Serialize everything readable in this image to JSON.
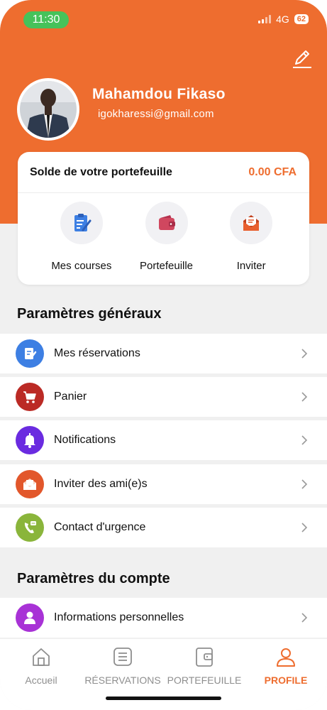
{
  "status_bar": {
    "time": "11:30",
    "network": "4G",
    "battery": "62"
  },
  "profile": {
    "name": "Mahamdou Fikaso",
    "email": "igokharessi@gmail.com"
  },
  "wallet": {
    "label": "Solde de votre portefeuille",
    "amount": "0.00 CFA"
  },
  "quick_actions": [
    {
      "label": "Mes courses",
      "icon": "clipboard-icon"
    },
    {
      "label": "Portefeuille",
      "icon": "wallet-icon"
    },
    {
      "label": "Inviter",
      "icon": "envelope-icon"
    }
  ],
  "general_settings": {
    "title": "Paramètres généraux",
    "items": [
      {
        "label": "Mes réservations",
        "icon": "reservation-icon",
        "color": "#3d7fe3"
      },
      {
        "label": "Panier",
        "icon": "cart-icon",
        "color": "#bb2a25"
      },
      {
        "label": "Notifications",
        "icon": "bell-icon",
        "color": "#6a2be0"
      },
      {
        "label": "Inviter des ami(e)s",
        "icon": "invite-icon",
        "color": "#e2572b"
      },
      {
        "label": "Contact d'urgence",
        "icon": "phone-icon",
        "color": "#8ab53b"
      }
    ]
  },
  "account_settings": {
    "title": "Paramètres du compte",
    "items": [
      {
        "label": "Informations personnelles",
        "icon": "user-icon",
        "color": "#a832d6"
      }
    ]
  },
  "tabbar": {
    "tabs": [
      {
        "label": "Accueil",
        "icon": "home-icon",
        "active": false
      },
      {
        "label": "RÉSERVATIONS",
        "icon": "list-icon",
        "active": false
      },
      {
        "label": "PORTEFEUILLE",
        "icon": "wallet-icon",
        "active": false
      },
      {
        "label": "PROFILE",
        "icon": "user-icon",
        "active": true
      }
    ]
  },
  "colors": {
    "accent": "#ee6d2f",
    "status_pill": "#46c25a"
  }
}
